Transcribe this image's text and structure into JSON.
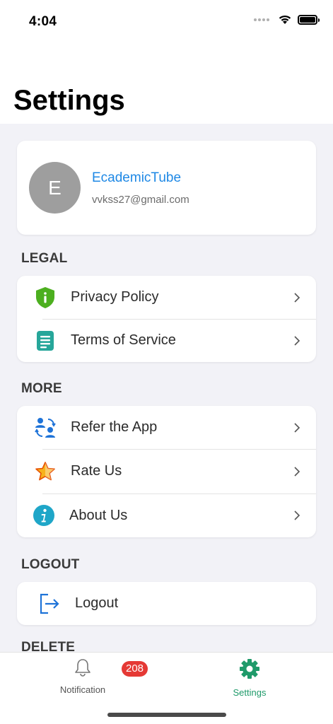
{
  "status_bar": {
    "time": "4:04"
  },
  "header": {
    "title": "Settings"
  },
  "profile": {
    "avatar_letter": "E",
    "name": "EcademicTube",
    "email": "vvkss27@gmail.com"
  },
  "sections": {
    "legal": {
      "label": "LEGAL",
      "items": [
        {
          "label": "Privacy Policy",
          "icon": "shield-info-icon"
        },
        {
          "label": "Terms of Service",
          "icon": "document-icon"
        }
      ]
    },
    "more": {
      "label": "MORE",
      "items": [
        {
          "label": "Refer the App",
          "icon": "refer-users-icon"
        },
        {
          "label": "Rate Us",
          "icon": "star-icon"
        },
        {
          "label": "About Us",
          "icon": "info-icon"
        }
      ]
    },
    "logout": {
      "label": "LOGOUT",
      "items": [
        {
          "label": "Logout",
          "icon": "logout-icon"
        }
      ]
    },
    "delete": {
      "label": "DELETE"
    }
  },
  "bottom_nav": {
    "notification": {
      "label": "Notification",
      "badge": "208"
    },
    "settings": {
      "label": "Settings"
    }
  },
  "colors": {
    "accent_blue": "#1e88e5",
    "active_tab": "#1f9a6a",
    "badge_red": "#e53935"
  }
}
